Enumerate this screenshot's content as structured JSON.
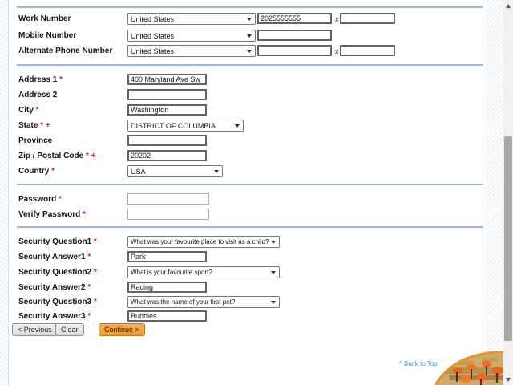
{
  "symbols": {
    "required": "*",
    "plus": "+",
    "ext_sep": "x"
  },
  "phone_rows": {
    "work": {
      "label": "Work Number",
      "country": "United States",
      "number": "2025555555",
      "ext": ""
    },
    "mobile": {
      "label": "Mobile Number",
      "country": "United States",
      "number": ""
    },
    "alternate": {
      "label": "Alternate Phone Number",
      "country": "United States",
      "number": "",
      "ext": ""
    }
  },
  "address": {
    "address1": {
      "label": "Address 1",
      "value": "400 Maryland Ave Sw"
    },
    "address2": {
      "label": "Address 2",
      "value": ""
    },
    "city": {
      "label": "City",
      "value": "Washington"
    },
    "state": {
      "label": "State",
      "value": "DISTRICT OF COLUMBIA"
    },
    "province": {
      "label": "Province",
      "value": ""
    },
    "zip": {
      "label": "Zip / Postal Code",
      "value": "20202"
    },
    "country": {
      "label": "Country",
      "value": "USA"
    }
  },
  "credentials": {
    "password": {
      "label": "Password",
      "value": ""
    },
    "verify_password": {
      "label": "Verify Password",
      "value": ""
    }
  },
  "security": {
    "question1": {
      "label": "Security Question1",
      "value": "What was your favourite place to visit as a child?"
    },
    "answer1": {
      "label": "Security Answer1",
      "value": "Park"
    },
    "question2": {
      "label": "Security Question2",
      "value": "What is your favourite sport?"
    },
    "answer2": {
      "label": "Security Answer2",
      "value": "Racing"
    },
    "question3": {
      "label": "Security Question3",
      "value": "What was the name of your first pet?"
    },
    "answer3": {
      "label": "Security Answer3",
      "value": "Bubbles"
    }
  },
  "buttons": {
    "previous": "< Previous",
    "clear": "Clear",
    "continue": "Continue >"
  },
  "footer": {
    "back_to_top": "^ Back to Top"
  },
  "images": {
    "corner": "classroom-chairs-photo"
  },
  "colors": {
    "divider": "#9cb8d6",
    "continue_bg": "#f2a440",
    "link": "#4d9bd0",
    "required": "#e02020"
  }
}
